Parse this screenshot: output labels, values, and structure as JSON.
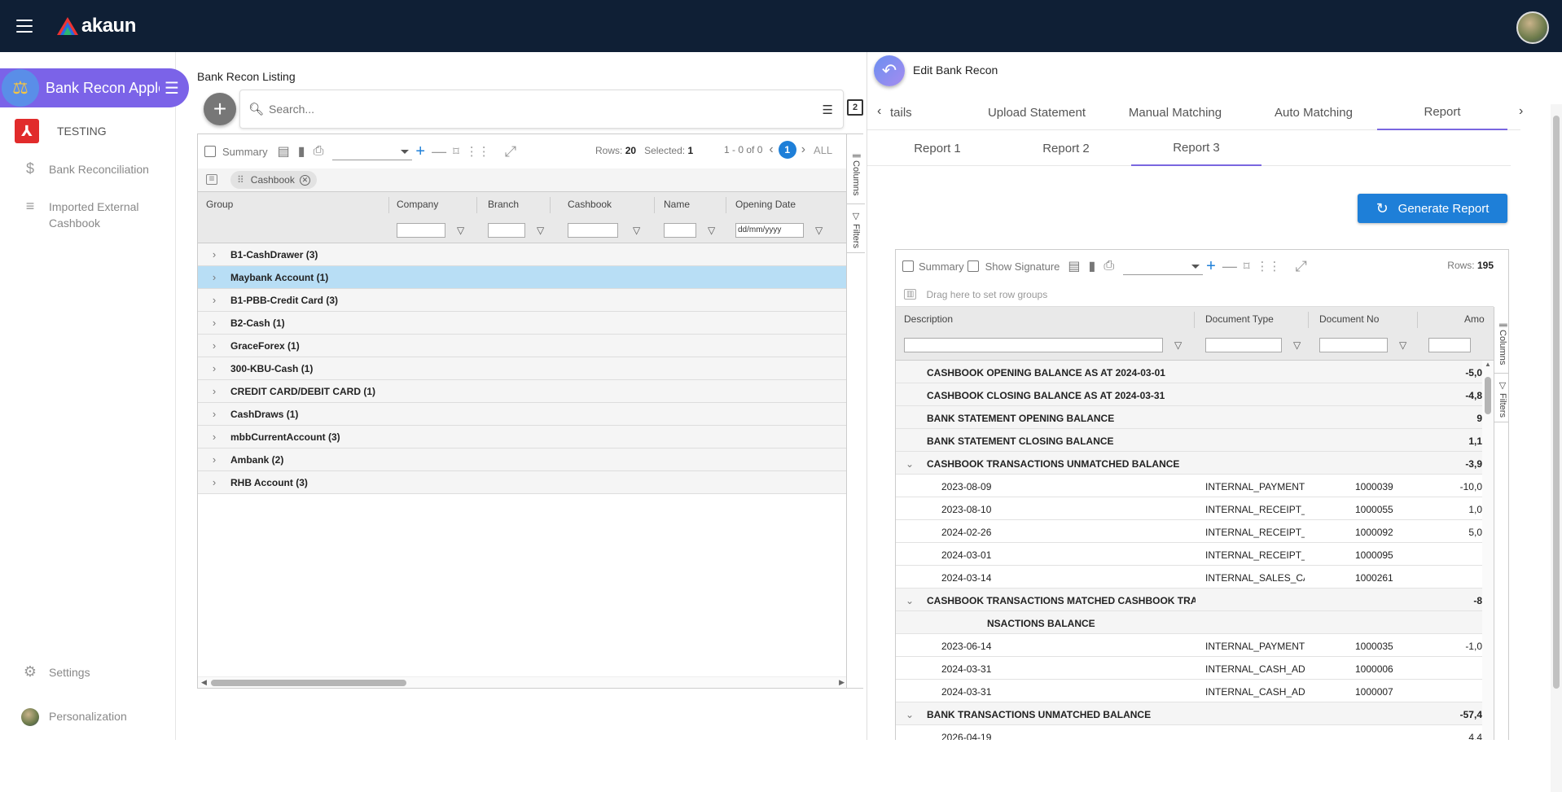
{
  "topbar": {
    "logo_text": "akaun"
  },
  "sidebar": {
    "app_name": "Bank Recon Apple",
    "tenant_name": "TESTING",
    "items": [
      {
        "label": "Bank Reconciliation",
        "icon": "dollar-icon"
      },
      {
        "label": "Imported External Cashbook",
        "icon": "playlist-add-icon"
      }
    ],
    "settings_label": "Settings",
    "personalization_label": "Personalization"
  },
  "listing": {
    "title": "Bank Recon Listing",
    "search_placeholder": "Search...",
    "copy_badge": "2",
    "toolbar": {
      "summary_label": "Summary",
      "rows_label": "Rows:",
      "rows_value": "20",
      "selected_label": "Selected:",
      "selected_value": "1",
      "range": "1 - 0 of 0",
      "current_page": "1",
      "all_label": "ALL"
    },
    "chip_label": "Cashbook",
    "columns": [
      "Group",
      "Company",
      "Branch",
      "Cashbook",
      "Name",
      "Opening Date"
    ],
    "date_placeholder": "dd/mm/yyyy",
    "groups": [
      "B1-CashDrawer (3)",
      "Maybank Account (1)",
      "B1-PBB-Credit Card (3)",
      "B2-Cash (1)",
      "GraceForex (1)",
      "300-KBU-Cash (1)",
      "CREDIT CARD/DEBIT CARD (1)",
      "CashDraws (1)",
      "mbbCurrentAccount (3)",
      "Ambank (2)",
      "RHB Account (3)"
    ],
    "side_tabs": [
      "Columns",
      "Filters"
    ]
  },
  "edit": {
    "title": "Edit Bank Recon",
    "tabs": [
      "tails",
      "Upload Statement",
      "Manual Matching",
      "Auto Matching",
      "Report"
    ],
    "active_tab": "Report",
    "report_tabs": [
      "Report 1",
      "Report 2",
      "Report 3"
    ],
    "active_report_tab": "Report 3",
    "generate_label": "Generate Report",
    "report_toolbar": {
      "summary_label": "Summary",
      "signature_label": "Show Signature",
      "rows_label": "Rows:",
      "rows_value": "195"
    },
    "drag_hint": "Drag here to set row groups",
    "columns": [
      "Description",
      "Document Type",
      "Document No",
      "Amo"
    ],
    "side_tabs": [
      "Columns",
      "Filters"
    ],
    "rows": [
      {
        "type": "grp",
        "desc": "CASHBOOK OPENING BALANCE AS AT 2024-03-01",
        "amt": "-5,0"
      },
      {
        "type": "grp",
        "desc": "CASHBOOK CLOSING BALANCE AS AT 2024-03-31",
        "amt": "-4,8"
      },
      {
        "type": "grp",
        "desc": "BANK STATEMENT OPENING BALANCE",
        "amt": "9"
      },
      {
        "type": "grp",
        "desc": "BANK STATEMENT CLOSING BALANCE",
        "amt": "1,1"
      },
      {
        "type": "grp-open",
        "desc": "CASHBOOK TRANSACTIONS UNMATCHED BALANCE",
        "amt": "-3,9"
      },
      {
        "type": "item",
        "desc": "2023-08-09",
        "doctype": "INTERNAL_PAYMENT...",
        "docno": "1000039",
        "amt": "-10,0"
      },
      {
        "type": "item",
        "desc": "2023-08-10",
        "doctype": "INTERNAL_RECEIPT_...",
        "docno": "1000055",
        "amt": "1,0"
      },
      {
        "type": "item",
        "desc": "2024-02-26",
        "doctype": "INTERNAL_RECEIPT_...",
        "docno": "1000092",
        "amt": "5,0"
      },
      {
        "type": "item",
        "desc": "2024-03-01",
        "doctype": "INTERNAL_RECEIPT_...",
        "docno": "1000095",
        "amt": ""
      },
      {
        "type": "item",
        "desc": "2024-03-14",
        "doctype": "INTERNAL_SALES_CA...",
        "docno": "1000261",
        "amt": ""
      },
      {
        "type": "grp-open",
        "desc": "CASHBOOK TRANSACTIONS MATCHED CASHBOOK TRA",
        "amt": "-8"
      },
      {
        "type": "grp-cont",
        "desc": "NSACTIONS BALANCE",
        "amt": ""
      },
      {
        "type": "item",
        "desc": "2023-06-14",
        "doctype": "INTERNAL_PAYMENT...",
        "docno": "1000035",
        "amt": "-1,0"
      },
      {
        "type": "item",
        "desc": "2024-03-31",
        "doctype": "INTERNAL_CASH_AD...",
        "docno": "1000006",
        "amt": ""
      },
      {
        "type": "item",
        "desc": "2024-03-31",
        "doctype": "INTERNAL_CASH_AD...",
        "docno": "1000007",
        "amt": ""
      },
      {
        "type": "grp-open",
        "desc": "BANK TRANSACTIONS UNMATCHED BALANCE",
        "amt": "-57,4"
      },
      {
        "type": "item",
        "desc": "2026-04-19",
        "doctype": "",
        "docno": "",
        "amt": "4,4"
      }
    ]
  }
}
